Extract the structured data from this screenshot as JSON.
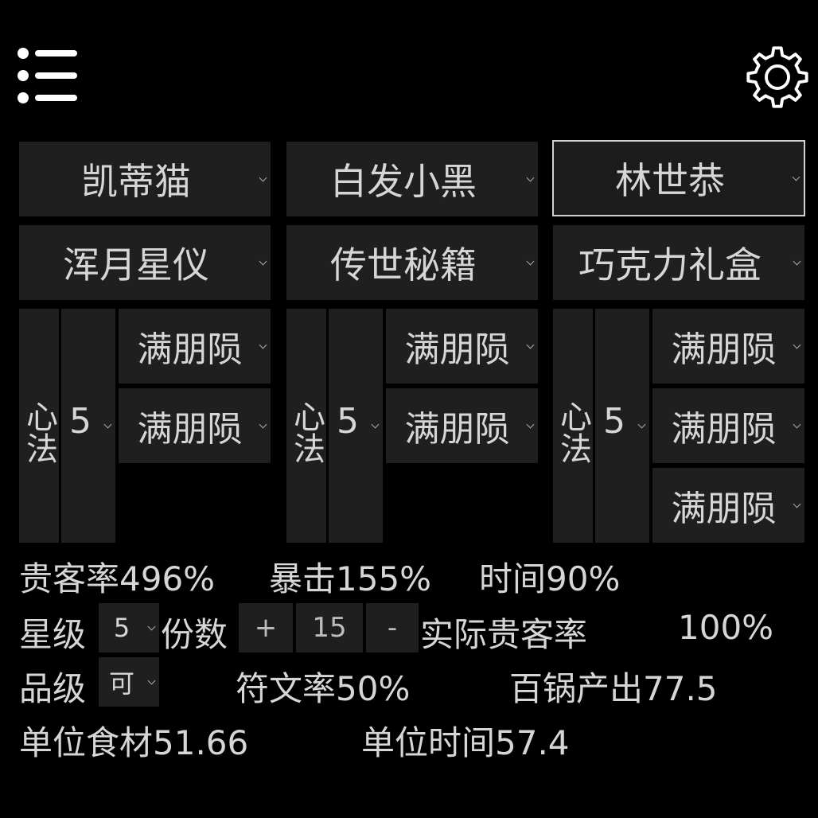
{
  "chefs": [
    {
      "name": "凯蒂猫",
      "equip": "浑月星仪",
      "xinfa_label": "心法",
      "xinfa_level": "5",
      "runes": [
        "满朋陨",
        "满朋陨"
      ]
    },
    {
      "name": "白发小黑",
      "equip": "传世秘籍",
      "xinfa_label": "心法",
      "xinfa_level": "5",
      "runes": [
        "满朋陨",
        "满朋陨"
      ]
    },
    {
      "name": "林世恭",
      "equip": "巧克力礼盒",
      "xinfa_label": "心法",
      "xinfa_level": "5",
      "runes": [
        "满朋陨",
        "满朋陨",
        "满朋陨"
      ]
    }
  ],
  "stats": {
    "guest_rate": "贵客率496%",
    "crit": "暴击155%",
    "time": "时间90%",
    "star_label": "星级",
    "star_value": "5",
    "portion_label": "份数",
    "plus": "+",
    "portion_value": "15",
    "minus": "-",
    "actual_label": "实际贵客率",
    "actual_value": "100%",
    "grade_label": "品级",
    "grade_value": "可",
    "rune_rate": "符文率50%",
    "hundred_output": "百锅产出77.5",
    "unit_ingredient": "单位食材51.66",
    "unit_time": "单位时间57.4"
  },
  "icons": {
    "menu": "menu-icon",
    "settings": "gear-icon"
  }
}
